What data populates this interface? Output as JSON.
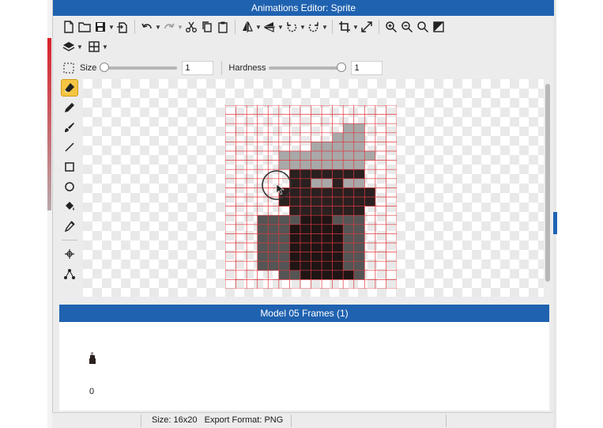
{
  "window": {
    "title": "Animations Editor: Sprite"
  },
  "toolbar": {
    "row1": [
      "new-file-icon",
      "open-folder-icon",
      "save-icon",
      "export-icon",
      "undo-icon",
      "redo-icon",
      "cut-icon",
      "copy-icon",
      "paste-icon",
      "flip-horizontal-icon",
      "flip-vertical-icon",
      "rotate-left-icon",
      "rotate-right-icon",
      "crop-icon",
      "resize-icon",
      "zoom-in-icon",
      "zoom-out-icon",
      "zoom-fit-icon",
      "fill-background-icon"
    ],
    "row2": [
      "layers-icon",
      "grid-icon"
    ]
  },
  "brush": {
    "size_label": "Size",
    "size_value": "1",
    "size_level": 0.0,
    "hardness_label": "Hardness",
    "hardness_value": "1",
    "hardness_level": 1.0
  },
  "tools": [
    "eraser-icon",
    "pencil-icon",
    "brush-icon",
    "line-icon",
    "rectangle-icon",
    "ellipse-icon",
    "paint-bucket-icon",
    "eyedropper-icon",
    "move-point-icon",
    "node-icon"
  ],
  "active_tool": "eraser-icon",
  "sprite": {
    "columns": 16,
    "rows": 20,
    "colors": {
      "1": "#a8a8a8",
      "2": "#555555",
      "3": "#2a2020",
      "4": "#1f1515"
    },
    "grid_color": "#e0393e",
    "pixels": [
      "................",
      "................",
      "...........11...",
      "..........111...",
      "........11111...",
      ".....111111111..",
      ".....11111111...",
      "......3333333...",
      "......3311311...",
      ".....333333333..",
      ".....333333333..",
      "......3333333...",
      "...2222444222...",
      "...2224444422...",
      "...2224444422...",
      "...2224444422...",
      "...2224444422...",
      "...2224444422...",
      ".....22444442...",
      "................"
    ]
  },
  "frames": {
    "title": "Model 05 Frames (1)",
    "items": [
      {
        "index": "0"
      }
    ]
  },
  "status": {
    "size_label": "Size: 16x20",
    "format_label": "Export Format: PNG"
  },
  "colors": {
    "title_bar": "#1f62b0",
    "active_tool": "#f4c542"
  }
}
